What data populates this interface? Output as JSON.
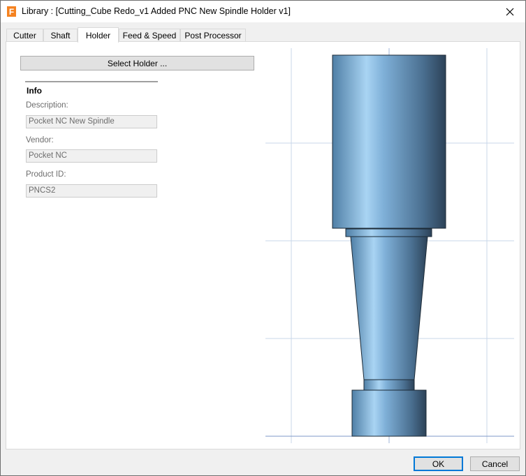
{
  "window": {
    "title": "Library :  [Cutting_Cube Redo_v1 Added PNC New Spindle Holder v1]",
    "app_icon_letter": "F",
    "app_icon_color": "#f58220"
  },
  "tabs": [
    {
      "label": "Cutter"
    },
    {
      "label": "Shaft"
    },
    {
      "label": "Holder",
      "active": true
    },
    {
      "label": "Feed & Speed"
    },
    {
      "label": "Post Processor"
    }
  ],
  "holder": {
    "select_button_label": "Select Holder ...",
    "info_title": "Info",
    "description_label": "Description:",
    "description_value": "Pocket NC New Spindle",
    "vendor_label": "Vendor:",
    "vendor_value": "Pocket NC",
    "product_id_label": "Product ID:",
    "product_id_value": "PNCS2"
  },
  "preview": {
    "grid_color": "#c9d7ea",
    "axis_color": "#7f98c8",
    "body_color": "#6e9fc6"
  },
  "buttons": {
    "ok_label": "OK",
    "cancel_label": "Cancel"
  }
}
